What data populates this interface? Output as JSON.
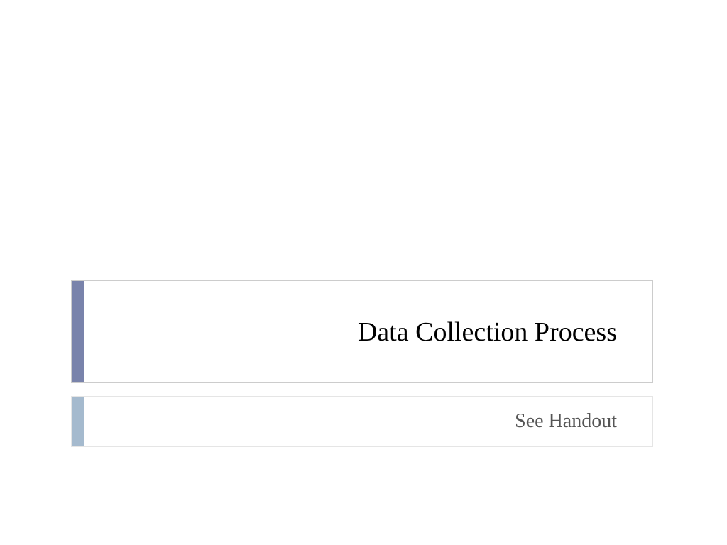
{
  "slide": {
    "title": "Data Collection Process",
    "subtitle": "See Handout",
    "colors": {
      "titleAccent": "#7983ab",
      "subtitleAccent": "#a5bace",
      "border": "#cccccc"
    }
  }
}
